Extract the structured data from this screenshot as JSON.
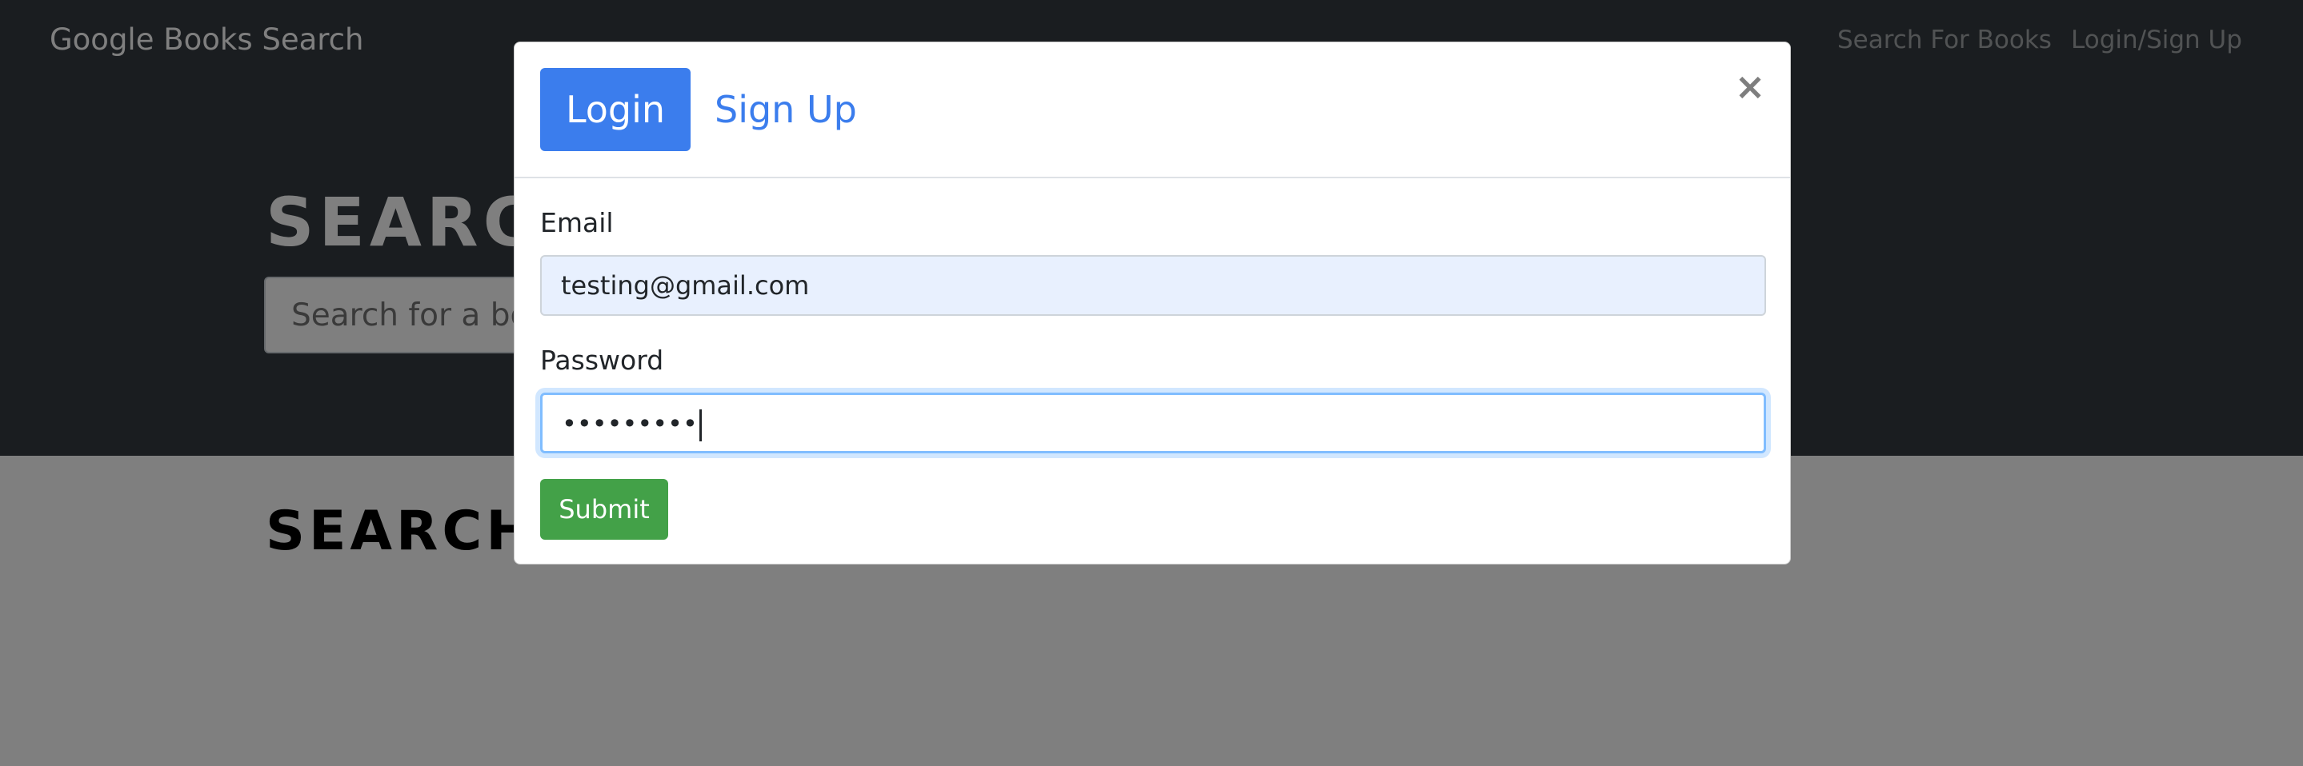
{
  "navbar": {
    "brand": "Google Books Search",
    "links": [
      "Search For Books",
      "Login/Sign Up"
    ]
  },
  "jumbotron": {
    "title": "SEARCH FOR BOOKS!",
    "search_placeholder": "Search for a book"
  },
  "results": {
    "title": "SEARCH FOR A BOOK TO BEGIN"
  },
  "modal": {
    "tabs": [
      "Login",
      "Sign Up"
    ],
    "active_tab": "Login",
    "close_label": "×",
    "email_label": "Email",
    "email_value": "testing@gmail.com",
    "password_label": "Password",
    "password_value": "•••••••••",
    "submit_label": "Submit"
  },
  "colors": {
    "navbar": "#343a40",
    "primary": "#3b7ded",
    "success": "#43a148",
    "autofill": "#e8f0fe"
  }
}
